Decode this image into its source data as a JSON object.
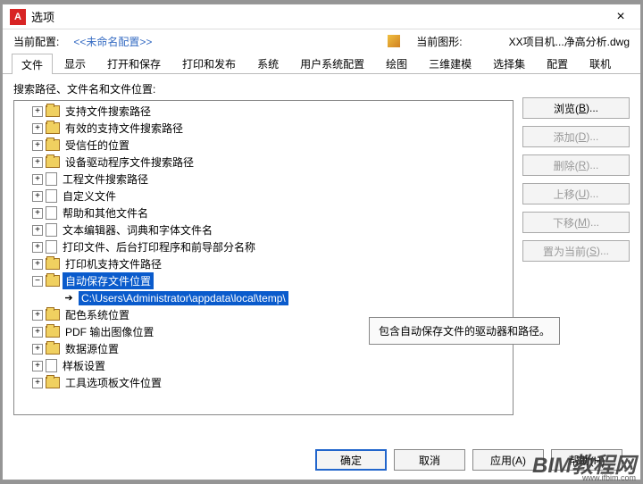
{
  "window": {
    "title": "选项"
  },
  "profile": {
    "current_label": "当前配置:",
    "current_value": "<<未命名配置>>",
    "drawing_label": "当前图形:",
    "drawing_value": "XX项目机...净高分析.dwg"
  },
  "tabs": [
    "文件",
    "显示",
    "打开和保存",
    "打印和发布",
    "系统",
    "用户系统配置",
    "绘图",
    "三维建模",
    "选择集",
    "配置",
    "联机"
  ],
  "active_tab": 0,
  "section_label": "搜索路径、文件名和文件位置:",
  "tree": [
    {
      "type": "folder",
      "expand": "+",
      "label": "支持文件搜索路径"
    },
    {
      "type": "folder",
      "expand": "+",
      "label": "有效的支持文件搜索路径"
    },
    {
      "type": "folder",
      "expand": "+",
      "label": "受信任的位置"
    },
    {
      "type": "folder",
      "expand": "+",
      "label": "设备驱动程序文件搜索路径"
    },
    {
      "type": "doc",
      "expand": "+",
      "label": "工程文件搜索路径"
    },
    {
      "type": "doc",
      "expand": "+",
      "label": "自定义文件"
    },
    {
      "type": "doc",
      "expand": "+",
      "label": "帮助和其他文件名"
    },
    {
      "type": "doc",
      "expand": "+",
      "label": "文本编辑器、词典和字体文件名"
    },
    {
      "type": "doc",
      "expand": "+",
      "label": "打印文件、后台打印程序和前导部分名称"
    },
    {
      "type": "folder",
      "expand": "+",
      "label": "打印机支持文件路径"
    },
    {
      "type": "folder",
      "expand": "-",
      "label": "自动保存文件位置",
      "selected": true,
      "children": [
        {
          "type": "path",
          "label": "C:\\Users\\Administrator\\appdata\\local\\temp\\",
          "selected": true
        }
      ]
    },
    {
      "type": "folder",
      "expand": "+",
      "label": "配色系统位置"
    },
    {
      "type": "folder",
      "expand": "+",
      "label": "PDF 输出图像位置"
    },
    {
      "type": "folder",
      "expand": "+",
      "label": "数据源位置"
    },
    {
      "type": "doc",
      "expand": "+",
      "label": "样板设置"
    },
    {
      "type": "folder",
      "expand": "+",
      "label": "工具选项板文件位置"
    }
  ],
  "side_buttons": [
    {
      "label": "浏览",
      "key": "B",
      "disabled": false
    },
    {
      "label": "添加",
      "key": "D",
      "disabled": true
    },
    {
      "label": "删除",
      "key": "R",
      "disabled": true
    },
    {
      "label": "上移",
      "key": "U",
      "disabled": true
    },
    {
      "label": "下移",
      "key": "M",
      "disabled": true
    },
    {
      "label": "置为当前",
      "key": "S",
      "disabled": true
    }
  ],
  "tooltip": "包含自动保存文件的驱动器和路径。",
  "footer": {
    "ok": "确定",
    "cancel": "取消",
    "apply": "应用(A)",
    "help": "帮助(H)"
  },
  "watermark": {
    "main": "BIM教程网",
    "sub": "www.ifbim.com"
  }
}
